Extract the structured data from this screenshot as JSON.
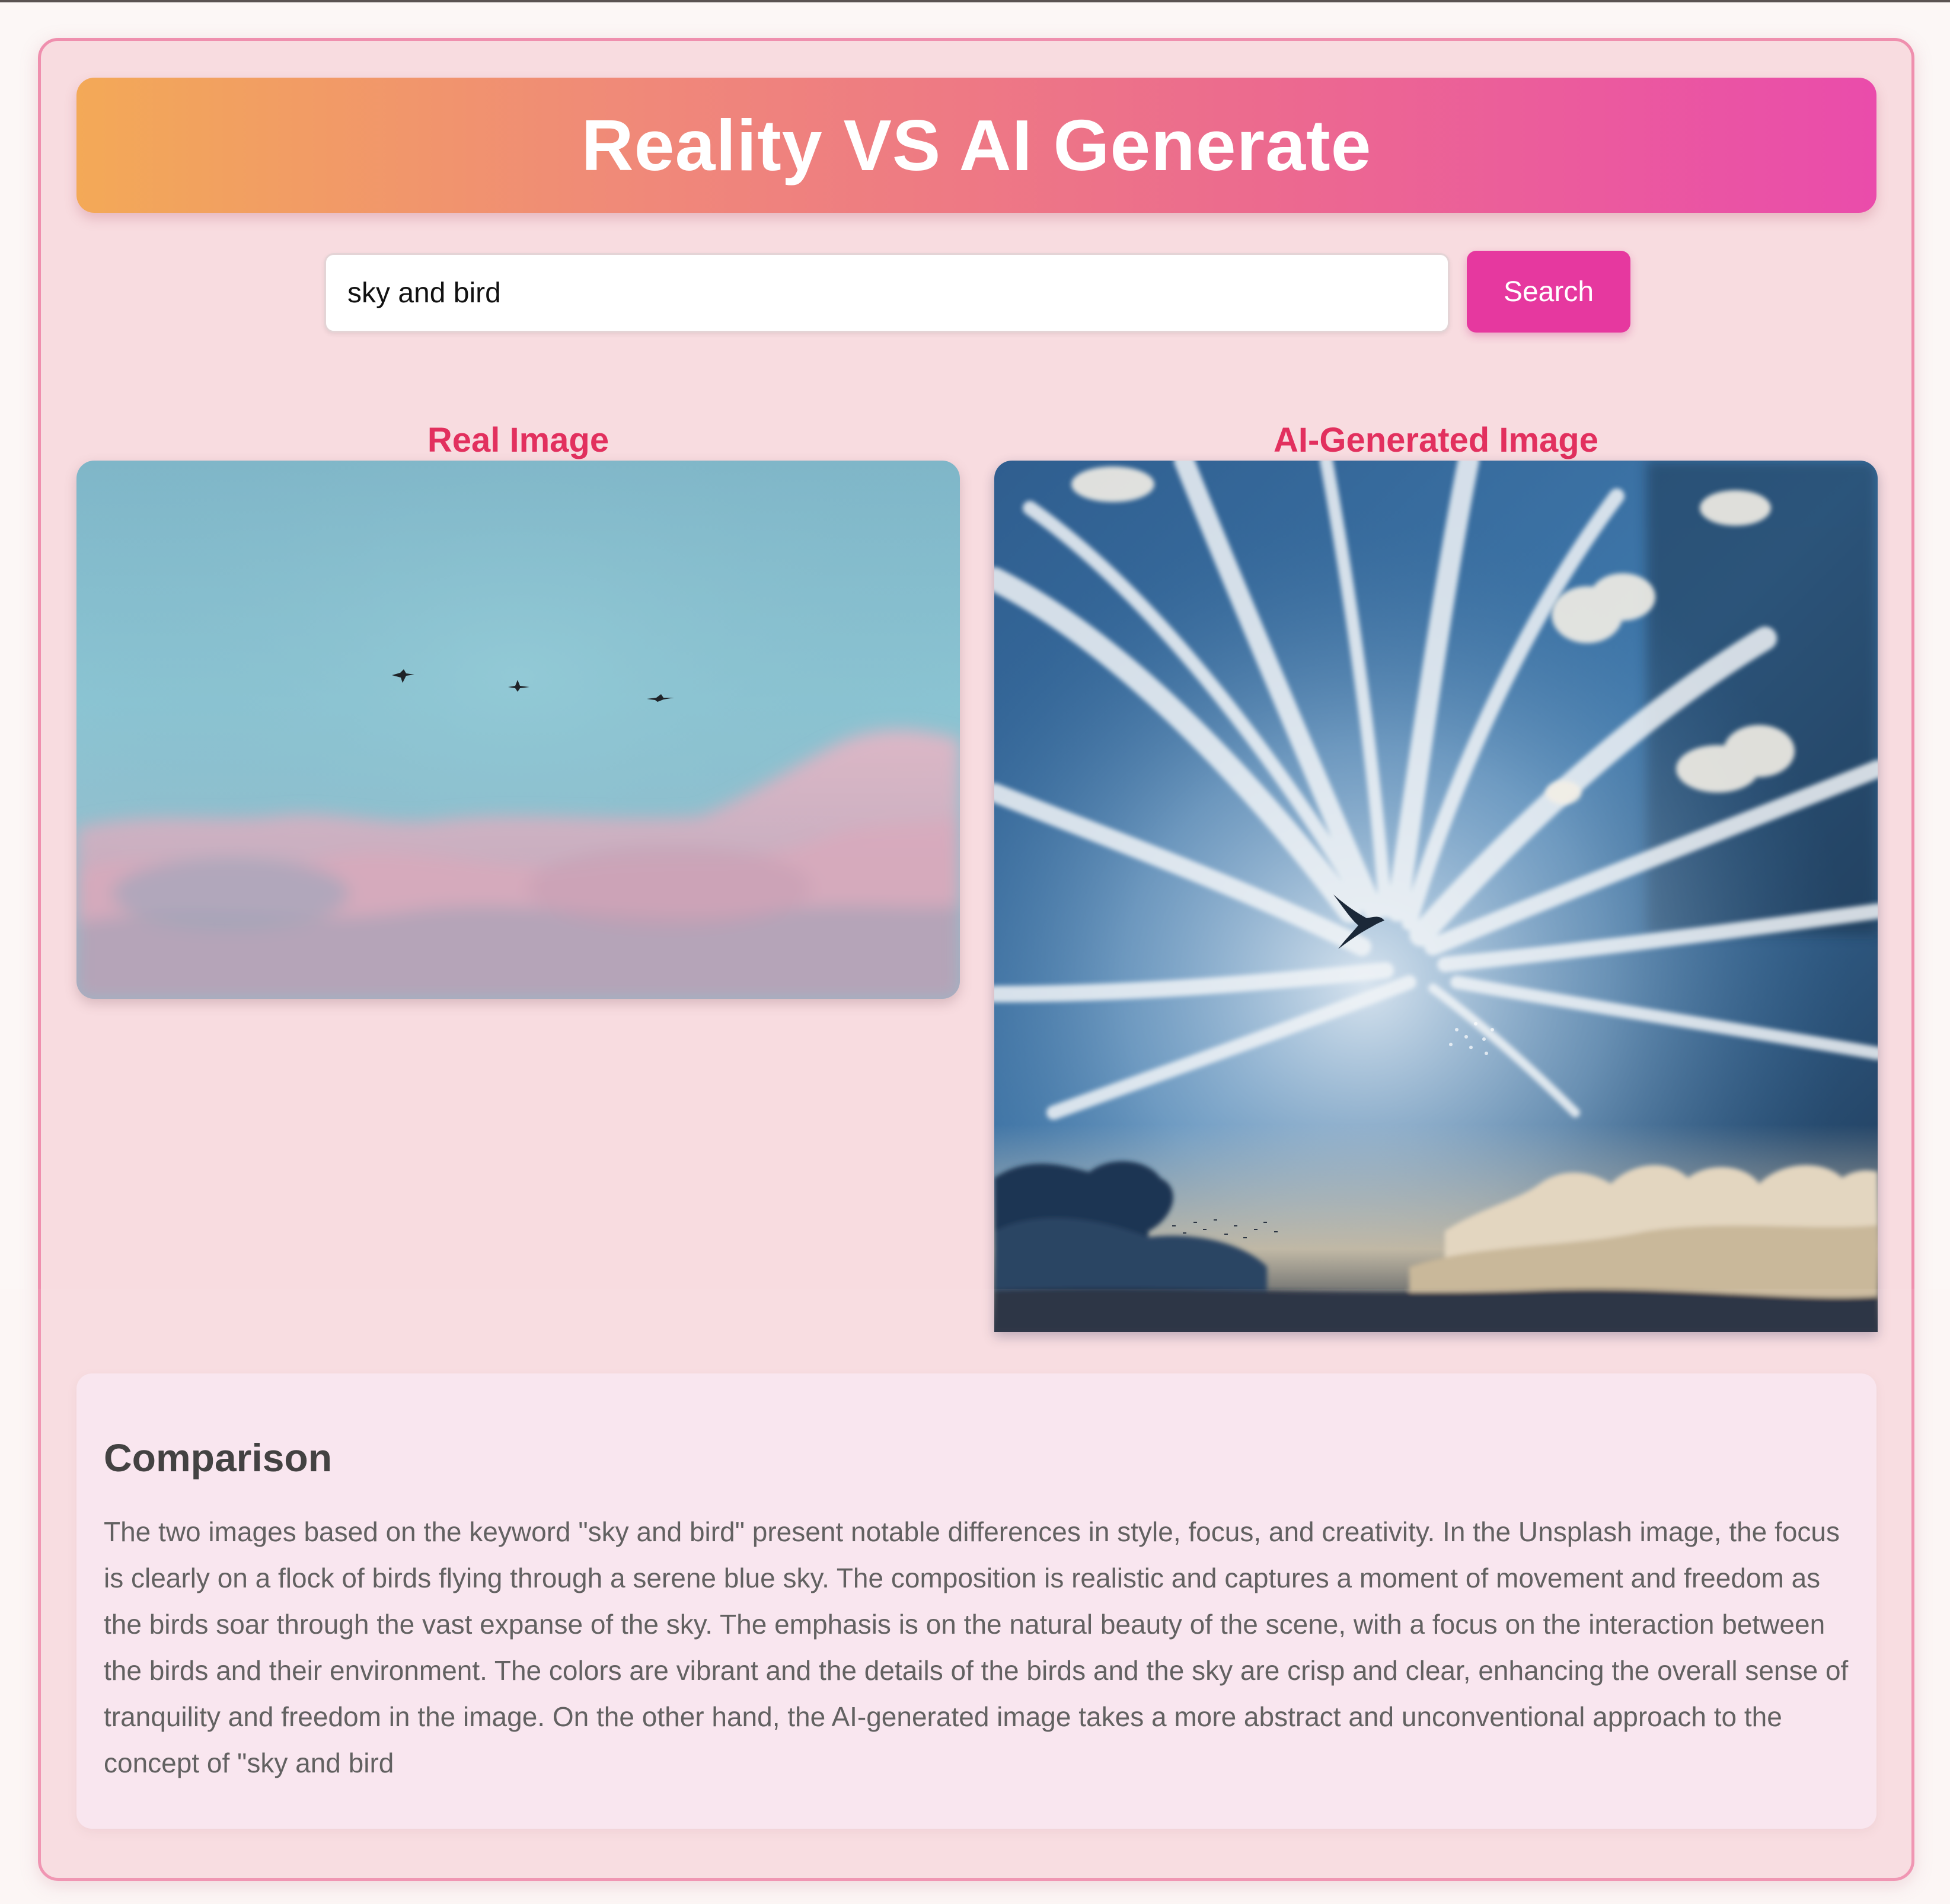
{
  "header": {
    "title": "Reality VS AI Generate"
  },
  "search": {
    "value": "sky and bird",
    "button_label": "Search"
  },
  "columns": {
    "real_title": "Real Image",
    "ai_title": "AI-Generated Image"
  },
  "comparison": {
    "title": "Comparison",
    "text": "The two images based on the keyword \"sky and bird\" present notable differences in style, focus, and creativity. In the Unsplash image, the focus is clearly on a flock of birds flying through a serene blue sky. The composition is realistic and captures a moment of movement and freedom as the birds soar through the vast expanse of the sky. The emphasis is on the natural beauty of the scene, with a focus on the interaction between the birds and their environment. The colors are vibrant and the details of the birds and the sky are crisp and clear, enhancing the overall sense of tranquility and freedom in the image. On the other hand, the AI-generated image takes a more abstract and unconventional approach to the concept of \"sky and bird"
  },
  "colors": {
    "accent": "#e6389f",
    "heading_red": "#e2305e",
    "header_gradient_start": "#f3a957",
    "header_gradient_end": "#ea4cab",
    "panel_bg": "#f8dce0"
  }
}
